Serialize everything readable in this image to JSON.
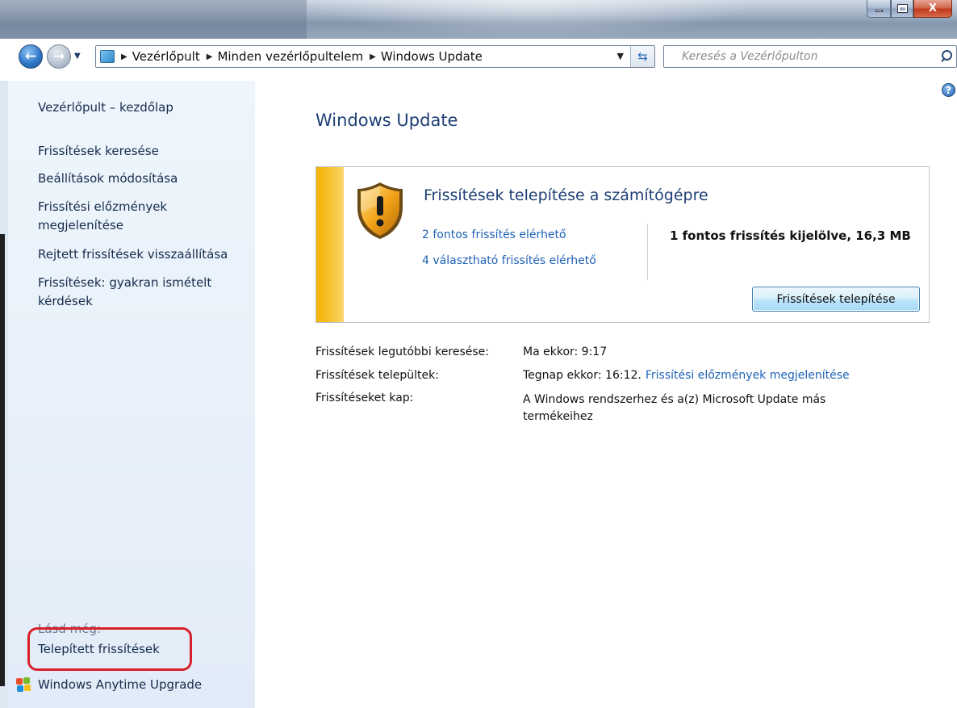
{
  "window": {
    "minimize_label": "–",
    "maximize_label": "□",
    "close_label": "X"
  },
  "address_bar": {
    "breadcrumbs": [
      "Vezérlőpult",
      "Minden vezérlőpultelem",
      "Windows Update"
    ],
    "search_placeholder": "Keresés a Vezérlőpulton"
  },
  "sidebar": {
    "home_link": "Vezérlőpult – kezdőlap",
    "tasks": [
      "Frissítések keresése",
      "Beállítások módosítása",
      "Frissítési előzmények megjelenítése",
      "Rejtett frissítések visszaállítása",
      "Frissítések: gyakran ismételt kérdések"
    ],
    "see_also_heading": "Lásd még:",
    "see_also": [
      "Telepített frissítések",
      "Windows Anytime Upgrade"
    ]
  },
  "main": {
    "title": "Windows Update",
    "panel": {
      "heading": "Frissítések telepítése a számítógépre",
      "important_link": "2 fontos frissítés elérhető",
      "optional_link": "4 választható frissítés elérhető",
      "selected_summary": "1 fontos frissítés kijelölve, 16,3 MB",
      "install_button": "Frissítések telepítése",
      "status_color": "#f4b400"
    },
    "info": {
      "last_check_label": "Frissítések legutóbbi keresése:",
      "last_check_value": "Ma ekkor: 9:17",
      "installed_label": "Frissítések települtek:",
      "installed_value": "Tegnap ekkor: 16:12.",
      "installed_link": "Frissítési előzmények megjelenítése",
      "receive_label": "Frissítéseket kap:",
      "receive_value": "A Windows rendszerhez és a(z) Microsoft Update más termékeihez"
    }
  },
  "colors": {
    "link": "#1f62b6",
    "title": "#1e3f75",
    "highlight": "#d9202a"
  }
}
